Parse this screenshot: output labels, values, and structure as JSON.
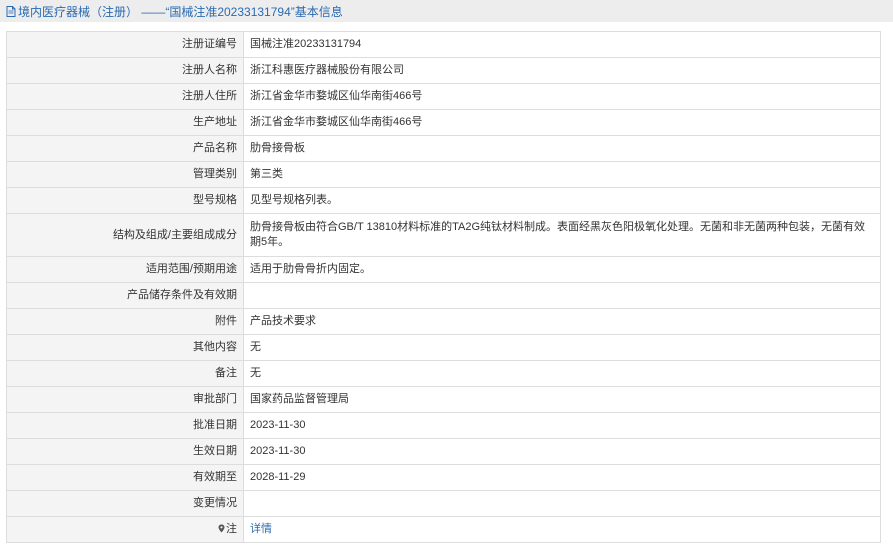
{
  "header": {
    "title": "境内医疗器械（注册） ——“国械注准20233131794”基本信息"
  },
  "rows": [
    {
      "label": "注册证编号",
      "value": "国械注准20233131794"
    },
    {
      "label": "注册人名称",
      "value": "浙江科惠医疗器械股份有限公司"
    },
    {
      "label": "注册人住所",
      "value": "浙江省金华市婺城区仙华南街466号"
    },
    {
      "label": "生产地址",
      "value": "浙江省金华市婺城区仙华南街466号"
    },
    {
      "label": "产品名称",
      "value": "肋骨接骨板"
    },
    {
      "label": "管理类别",
      "value": "第三类"
    },
    {
      "label": "型号规格",
      "value": "见型号规格列表。"
    },
    {
      "label": "结构及组成/主要组成成分",
      "value": "肋骨接骨板由符合GB/T 13810材料标准的TA2G纯钛材料制成。表面经黑灰色阳极氧化处理。无菌和非无菌两种包装，无菌有效期5年。"
    },
    {
      "label": "适用范围/预期用途",
      "value": "适用于肋骨骨折内固定。"
    },
    {
      "label": "产品储存条件及有效期",
      "value": ""
    },
    {
      "label": "附件",
      "value": "产品技术要求"
    },
    {
      "label": "其他内容",
      "value": "无"
    },
    {
      "label": "备注",
      "value": "无"
    },
    {
      "label": "审批部门",
      "value": "国家药品监督管理局"
    },
    {
      "label": "批准日期",
      "value": "2023-11-30"
    },
    {
      "label": "生效日期",
      "value": "2023-11-30"
    },
    {
      "label": "有效期至",
      "value": "2028-11-29"
    },
    {
      "label": "变更情况",
      "value": ""
    }
  ],
  "note_row": {
    "label": "注",
    "link_text": "详情",
    "icon": "pin-icon"
  },
  "colors": {
    "accent": "#2a6ab2",
    "header_bg": "#ededed",
    "label_bg": "#f4f4f4",
    "border": "#dddddd"
  }
}
